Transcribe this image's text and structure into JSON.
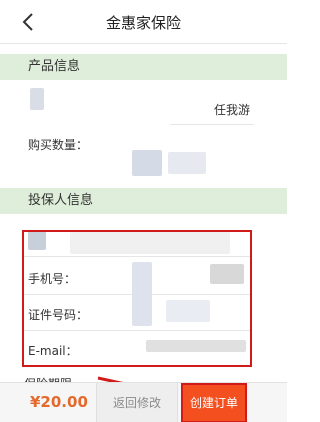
{
  "header": {
    "title": "金惠家保险"
  },
  "sections": {
    "product": "产品信息",
    "insured": "投保人信息",
    "period": "保险期限"
  },
  "product": {
    "plan_value": "任我游",
    "quantity_label": "购买数量："
  },
  "insured": {
    "phone_label": "手机号：",
    "id_label": "证件号码：",
    "email_label": "E-mail："
  },
  "footer": {
    "price": "¥20.00",
    "back_label": "返回修改",
    "create_label": "创建订单"
  },
  "colors": {
    "section_bg": "#dfeeda",
    "accent_orange": "#f4501f",
    "price_color": "#e36a2c",
    "highlight_red": "#d11b1b"
  },
  "icons": {
    "back": "chevron-left-icon",
    "annotation": "arrow-annotation"
  }
}
